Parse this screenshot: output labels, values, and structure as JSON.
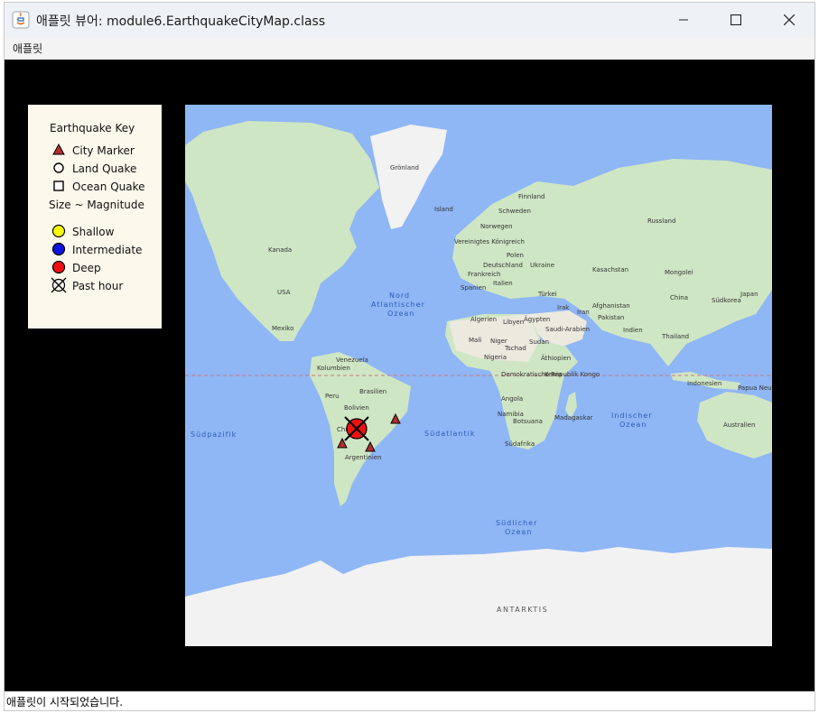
{
  "window": {
    "title": "애플릿 뷰어: module6.EarthquakeCityMap.class"
  },
  "menu": {
    "items": [
      "애플릿"
    ]
  },
  "status": {
    "text": "애플릿이 시작되었습니다."
  },
  "legend": {
    "title": "Earthquake Key",
    "city_marker": "City Marker",
    "land_quake": "Land Quake",
    "ocean_quake": "Ocean Quake",
    "size_label": "Size ~ Magnitude",
    "shallow": "Shallow",
    "intermediate": "Intermediate",
    "deep": "Deep",
    "past_hour": "Past hour"
  },
  "map": {
    "labels": {
      "groenland": "Grönland",
      "island": "Island",
      "finnland": "Finnland",
      "schweden": "Schweden",
      "norwegen": "Norwegen",
      "russland": "Russland",
      "uk": "Vereinigtes Königreich",
      "polen": "Polen",
      "deutschland": "Deutschland",
      "ukraine": "Ukraine",
      "frankreich": "Frankreich",
      "spanien": "Spanien",
      "italien": "Italien",
      "kasachstan": "Kasachstan",
      "mongolei": "Mongolei",
      "tuerkei": "Türkei",
      "afghanistan": "Afghanistan",
      "irak": "Irak",
      "iran": "Iran",
      "pakistan": "Pakistan",
      "china": "China",
      "suedkorea": "Südkorea",
      "japan": "Japan",
      "indien": "Indien",
      "thailand": "Thailand",
      "indonesien": "Indonesien",
      "papua": "Papua Neug",
      "kanada": "Kanada",
      "usa": "USA",
      "mexiko": "Mexiko",
      "venezuela": "Venezuela",
      "kolumbien": "Kolumbien",
      "peru": "Peru",
      "brasilien": "Brasilien",
      "bolivien": "Bolivien",
      "chile": "Chile",
      "argentinien": "Argentinien",
      "algerien": "Algerien",
      "libyen": "Libyen",
      "aegypten": "Ägypten",
      "saudi": "Saudi-Arabien",
      "mali": "Mali",
      "niger": "Niger",
      "tschad": "Tschad",
      "sudan": "Sudan",
      "nigeria": "Nigeria",
      "aethiopien": "Äthiopien",
      "kongo_demrep": "Demokratische Republik Kongo",
      "kenia": "Kenia",
      "angola": "Angola",
      "namibia": "Namibia",
      "botsuana": "Botsuana",
      "madagaskar": "Madagaskar",
      "suedafrika": "Südafrika",
      "australien": "Australien",
      "nord_atl_1": "Nord",
      "nord_atl_2": "Atlantischer",
      "nord_atl_3": "Ozean",
      "suedpazifik": "Südpazifik",
      "suedatlantik": "Südatlantik",
      "indischer_1": "Indischer",
      "indischer_2": "Ozean",
      "suedl_1": "Südlicher",
      "suedl_2": "Ozean",
      "antarktis": "ANTARKTIS"
    },
    "colors": {
      "ocean": "#8fb6f5",
      "land": "#cfe6c4",
      "desert": "#ece9df",
      "ice": "#f2f2f2",
      "equator": "#c87878"
    }
  },
  "markers": {
    "colors": {
      "city": "#b03030",
      "deep": "#ee1111",
      "shallow": "#ffff00",
      "intermediate": "#0a14e0"
    }
  }
}
